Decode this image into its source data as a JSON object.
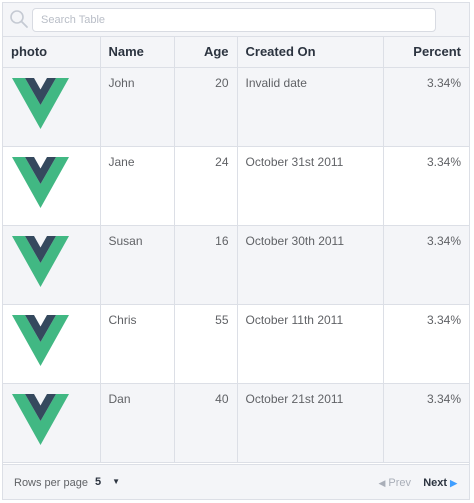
{
  "search": {
    "placeholder": "Search Table",
    "value": ""
  },
  "table": {
    "columns": [
      {
        "key": "photo",
        "label": "photo"
      },
      {
        "key": "name",
        "label": "Name"
      },
      {
        "key": "age",
        "label": "Age"
      },
      {
        "key": "created_on",
        "label": "Created On"
      },
      {
        "key": "percent",
        "label": "Percent"
      }
    ],
    "rows": [
      {
        "photo": "vue-logo-icon",
        "name": "John",
        "age": "20",
        "created_on": "Invalid date",
        "percent": "3.34%"
      },
      {
        "photo": "vue-logo-icon",
        "name": "Jane",
        "age": "24",
        "created_on": "October 31st 2011",
        "percent": "3.34%"
      },
      {
        "photo": "vue-logo-icon",
        "name": "Susan",
        "age": "16",
        "created_on": "October 30th 2011",
        "percent": "3.34%"
      },
      {
        "photo": "vue-logo-icon",
        "name": "Chris",
        "age": "55",
        "created_on": "October 11th 2011",
        "percent": "3.34%"
      },
      {
        "photo": "vue-logo-icon",
        "name": "Dan",
        "age": "40",
        "created_on": "October 21st 2011",
        "percent": "3.34%"
      }
    ]
  },
  "pagination": {
    "rows_per_page_label": "Rows per page",
    "rows_per_page_value": "5",
    "prev_label": "Prev",
    "next_label": "Next"
  },
  "colors": {
    "logo_outer": "#41b883",
    "logo_inner": "#35495e",
    "header_bg": "#f4f5f8",
    "border": "#dcdfe6",
    "next_arrow": "#409eff"
  }
}
